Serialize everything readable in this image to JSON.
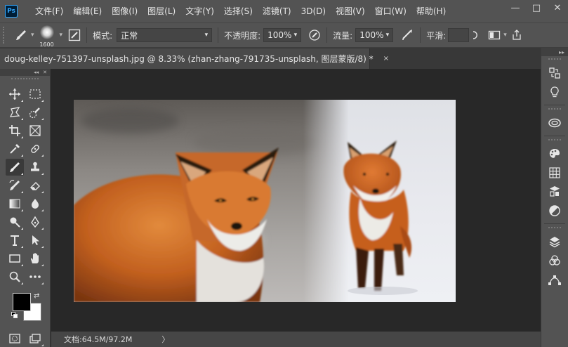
{
  "app": {
    "logo_text": "Ps"
  },
  "menu": {
    "items": [
      "文件(F)",
      "编辑(E)",
      "图像(I)",
      "图层(L)",
      "文字(Y)",
      "选择(S)",
      "滤镜(T)",
      "3D(D)",
      "视图(V)",
      "窗口(W)",
      "帮助(H)"
    ]
  },
  "window_controls": {
    "minimize": "—",
    "maximize": "□",
    "close": "✕"
  },
  "options_bar": {
    "brush_size": "1600",
    "mode_label": "模式:",
    "mode_value": "正常",
    "opacity_label": "不透明度:",
    "opacity_value": "100%",
    "flow_label": "流量:",
    "flow_value": "100%",
    "smoothing_label": "平滑:",
    "smoothing_value": ""
  },
  "document": {
    "tab_title": "doug-kelley-751397-unsplash.jpg @ 8.33% (zhan-zhang-791735-unsplash, 图层蒙版/8) *",
    "tab_close": "×"
  },
  "toolbar": {
    "collapse": "◂◂",
    "close": "✕",
    "tools": [
      [
        "move-tool-icon",
        "marquee-tool-icon"
      ],
      [
        "lasso-tool-icon",
        "quick-selection-tool-icon"
      ],
      [
        "crop-tool-icon",
        "frame-tool-icon"
      ],
      [
        "eyedropper-tool-icon",
        "healing-brush-tool-icon"
      ],
      [
        "brush-tool-icon",
        "clone-stamp-tool-icon"
      ],
      [
        "history-brush-tool-icon",
        "eraser-tool-icon"
      ],
      [
        "gradient-tool-icon",
        "blur-tool-icon"
      ],
      [
        "dodge-tool-icon",
        "pen-tool-icon"
      ],
      [
        "type-tool-icon",
        "path-selection-tool-icon"
      ],
      [
        "rectangle-tool-icon",
        "hand-tool-icon"
      ],
      [
        "zoom-tool-icon",
        "more-tools-icon"
      ]
    ],
    "selected_tool": "brush-tool-icon",
    "foreground_color": "#000000",
    "background_color": "#ffffff"
  },
  "status_bar": {
    "doc_info": "文档:64.5M/97.2M",
    "arrow": "〉"
  },
  "right_dock": {
    "collapse": "▸▸",
    "icons": [
      "history-panel-icon",
      "learn-panel-icon",
      "libraries-panel-icon",
      "color-panel-icon",
      "swatches-panel-icon",
      "adjustments-panel-icon",
      "styles-panel-icon",
      "layers-panel-icon",
      "channels-panel-icon",
      "paths-panel-icon"
    ]
  },
  "colors": {
    "ui_panel": "#535353",
    "canvas_bg": "#282828",
    "accent": "#31a8ff"
  }
}
